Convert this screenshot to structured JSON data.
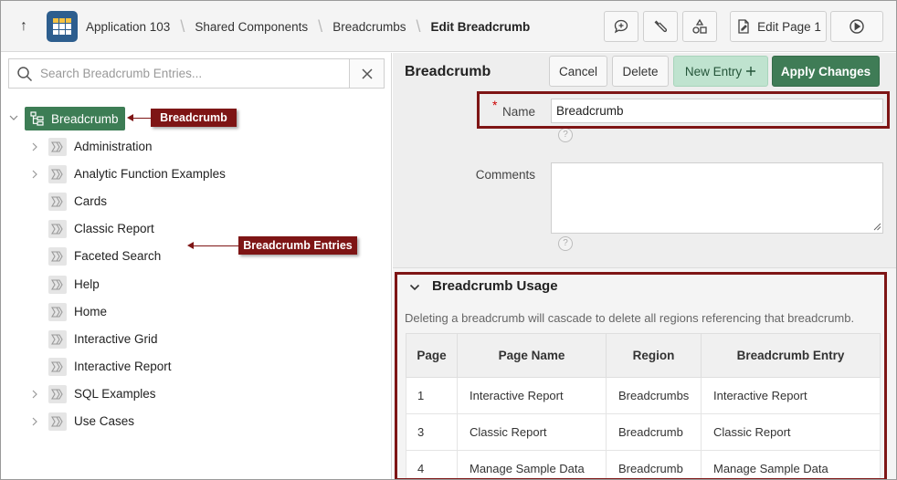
{
  "topbar": {
    "up_label": "↑",
    "breadcrumbs": [
      "Application 103",
      "Shared Components",
      "Breadcrumbs"
    ],
    "current": "Edit Breadcrumb",
    "edit_page_label": "Edit Page 1"
  },
  "left": {
    "search_placeholder": "Search Breadcrumb Entries...",
    "root_label": "Breadcrumb",
    "entries": [
      {
        "label": "Administration",
        "expandable": true
      },
      {
        "label": "Analytic Function Examples",
        "expandable": true
      },
      {
        "label": "Cards",
        "expandable": false
      },
      {
        "label": "Classic Report",
        "expandable": false
      },
      {
        "label": "Faceted Search",
        "expandable": false
      },
      {
        "label": "Help",
        "expandable": false
      },
      {
        "label": "Home",
        "expandable": false
      },
      {
        "label": "Interactive Grid",
        "expandable": false
      },
      {
        "label": "Interactive Report",
        "expandable": false
      },
      {
        "label": "SQL Examples",
        "expandable": true
      },
      {
        "label": "Use Cases",
        "expandable": true
      }
    ]
  },
  "callouts": {
    "breadcrumb": "Breadcrumb",
    "entries": "Breadcrumb Entries"
  },
  "right": {
    "title": "Breadcrumb",
    "buttons": {
      "cancel": "Cancel",
      "delete": "Delete",
      "new_entry": "New Entry",
      "apply": "Apply Changes"
    },
    "form": {
      "name_label": "Name",
      "required_mark": "*",
      "name_value": "Breadcrumb",
      "comments_label": "Comments",
      "comments_value": "",
      "help_glyph": "?"
    },
    "usage": {
      "title": "Breadcrumb Usage",
      "description": "Deleting a breadcrumb will cascade to delete all regions referencing that breadcrumb.",
      "columns": [
        "Page",
        "Page Name",
        "Region",
        "Breadcrumb Entry"
      ],
      "rows": [
        [
          "1",
          "Interactive Report",
          "Breadcrumbs",
          "Interactive Report"
        ],
        [
          "3",
          "Classic Report",
          "Breadcrumb",
          "Classic Report"
        ],
        [
          "4",
          "Manage Sample Data",
          "Breadcrumb",
          "Manage Sample Data"
        ]
      ]
    }
  },
  "colors": {
    "accent_green": "#3f7c56",
    "callout_red": "#7e1515",
    "app_icon_blue": "#2d5e8e"
  }
}
